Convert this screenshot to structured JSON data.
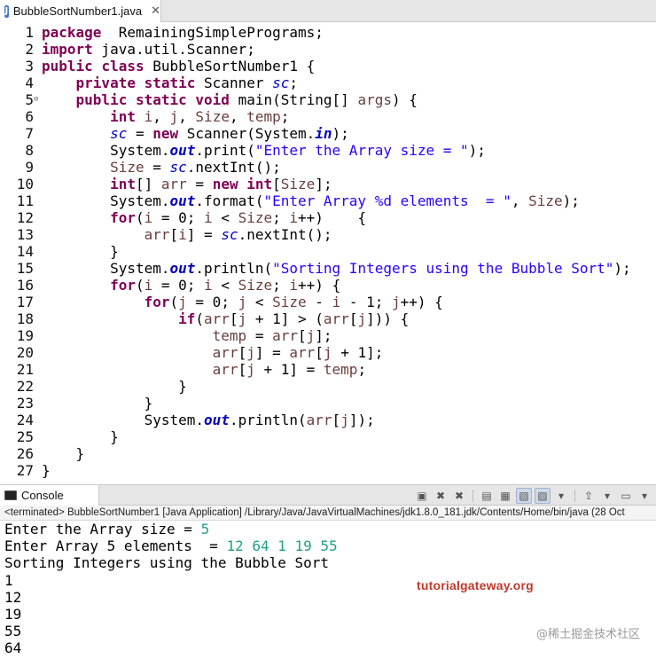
{
  "editor_tab": {
    "title": "BubbleSortNumber1.java",
    "close": "✕",
    "file_icon_letter": "J"
  },
  "code_lines": [
    {
      "num": "1",
      "fold": "",
      "segs": [
        [
          "kw",
          "package"
        ],
        [
          "",
          "  RemainingSimplePrograms;"
        ]
      ]
    },
    {
      "num": "2",
      "fold": "",
      "segs": [
        [
          "kw",
          "import"
        ],
        [
          "",
          " java.util.Scanner;"
        ]
      ]
    },
    {
      "num": "3",
      "fold": "",
      "segs": [
        [
          "kw",
          "public"
        ],
        [
          "",
          " "
        ],
        [
          "kw",
          "class"
        ],
        [
          "",
          " BubbleSortNumber1 {"
        ]
      ]
    },
    {
      "num": "4",
      "fold": "",
      "segs": [
        [
          "",
          "    "
        ],
        [
          "kw",
          "private"
        ],
        [
          "",
          " "
        ],
        [
          "kw",
          "static"
        ],
        [
          "",
          " Scanner "
        ],
        [
          "fld",
          "sc"
        ],
        [
          "",
          ";"
        ]
      ]
    },
    {
      "num": "5",
      "fold": "⊖",
      "segs": [
        [
          "",
          "    "
        ],
        [
          "kw",
          "public"
        ],
        [
          "",
          " "
        ],
        [
          "kw",
          "static"
        ],
        [
          "",
          " "
        ],
        [
          "kw",
          "void"
        ],
        [
          "",
          " main(String[] "
        ],
        [
          "var",
          "args"
        ],
        [
          "",
          ") {"
        ]
      ]
    },
    {
      "num": "6",
      "fold": "",
      "segs": [
        [
          "",
          "        "
        ],
        [
          "kw",
          "int"
        ],
        [
          "",
          " "
        ],
        [
          "var",
          "i"
        ],
        [
          "",
          ", "
        ],
        [
          "var",
          "j"
        ],
        [
          "",
          ", "
        ],
        [
          "var",
          "Size"
        ],
        [
          "",
          ", "
        ],
        [
          "var",
          "temp"
        ],
        [
          "",
          ";"
        ]
      ]
    },
    {
      "num": "7",
      "fold": "",
      "segs": [
        [
          "",
          "        "
        ],
        [
          "fld",
          "sc"
        ],
        [
          "",
          " = "
        ],
        [
          "kw",
          "new"
        ],
        [
          "",
          " Scanner(System."
        ],
        [
          "fldb",
          "in"
        ],
        [
          "",
          ");"
        ]
      ]
    },
    {
      "num": "8",
      "fold": "",
      "segs": [
        [
          "",
          "        System."
        ],
        [
          "fldb",
          "out"
        ],
        [
          "",
          ".print("
        ],
        [
          "str",
          "\"Enter the Array size = \""
        ],
        [
          "",
          ");"
        ]
      ]
    },
    {
      "num": "9",
      "fold": "",
      "segs": [
        [
          "",
          "        "
        ],
        [
          "var",
          "Size"
        ],
        [
          "",
          " = "
        ],
        [
          "fld",
          "sc"
        ],
        [
          "",
          ".nextInt();"
        ]
      ]
    },
    {
      "num": "10",
      "fold": "",
      "segs": [
        [
          "",
          "        "
        ],
        [
          "kw",
          "int"
        ],
        [
          "",
          "[] "
        ],
        [
          "var",
          "arr"
        ],
        [
          "",
          " = "
        ],
        [
          "kw",
          "new"
        ],
        [
          "",
          " "
        ],
        [
          "kw",
          "int"
        ],
        [
          "",
          "["
        ],
        [
          "var",
          "Size"
        ],
        [
          "",
          "];"
        ]
      ]
    },
    {
      "num": "11",
      "fold": "",
      "segs": [
        [
          "",
          "        System."
        ],
        [
          "fldb",
          "out"
        ],
        [
          "",
          ".format("
        ],
        [
          "str",
          "\"Enter Array %d elements  = \""
        ],
        [
          "",
          ", "
        ],
        [
          "var",
          "Size"
        ],
        [
          "",
          ");"
        ]
      ]
    },
    {
      "num": "12",
      "fold": "",
      "segs": [
        [
          "",
          "        "
        ],
        [
          "kw",
          "for"
        ],
        [
          "",
          "("
        ],
        [
          "var",
          "i"
        ],
        [
          "",
          " = 0; "
        ],
        [
          "var",
          "i"
        ],
        [
          "",
          " < "
        ],
        [
          "var",
          "Size"
        ],
        [
          "",
          "; "
        ],
        [
          "var",
          "i"
        ],
        [
          "",
          "++)    {"
        ]
      ]
    },
    {
      "num": "13",
      "fold": "",
      "segs": [
        [
          "",
          "            "
        ],
        [
          "var",
          "arr"
        ],
        [
          "",
          "["
        ],
        [
          "var",
          "i"
        ],
        [
          "",
          "] = "
        ],
        [
          "fld",
          "sc"
        ],
        [
          "",
          ".nextInt();"
        ]
      ]
    },
    {
      "num": "14",
      "fold": "",
      "segs": [
        [
          "",
          "        }"
        ]
      ]
    },
    {
      "num": "15",
      "fold": "",
      "segs": [
        [
          "",
          "        System."
        ],
        [
          "fldb",
          "out"
        ],
        [
          "",
          ".println("
        ],
        [
          "str",
          "\"Sorting Integers using the Bubble Sort\""
        ],
        [
          "",
          ");"
        ]
      ]
    },
    {
      "num": "16",
      "fold": "",
      "segs": [
        [
          "",
          "        "
        ],
        [
          "kw",
          "for"
        ],
        [
          "",
          "("
        ],
        [
          "var",
          "i"
        ],
        [
          "",
          " = 0; "
        ],
        [
          "var",
          "i"
        ],
        [
          "",
          " < "
        ],
        [
          "var",
          "Size"
        ],
        [
          "",
          "; "
        ],
        [
          "var",
          "i"
        ],
        [
          "",
          "++) {"
        ]
      ]
    },
    {
      "num": "17",
      "fold": "",
      "segs": [
        [
          "",
          "            "
        ],
        [
          "kw",
          "for"
        ],
        [
          "",
          "("
        ],
        [
          "var",
          "j"
        ],
        [
          "",
          " = 0; "
        ],
        [
          "var",
          "j"
        ],
        [
          "",
          " < "
        ],
        [
          "var",
          "Size"
        ],
        [
          "",
          " - "
        ],
        [
          "var",
          "i"
        ],
        [
          "",
          " - 1; "
        ],
        [
          "var",
          "j"
        ],
        [
          "",
          "++) {"
        ]
      ]
    },
    {
      "num": "18",
      "fold": "",
      "segs": [
        [
          "",
          "                "
        ],
        [
          "kw",
          "if"
        ],
        [
          "",
          "("
        ],
        [
          "var",
          "arr"
        ],
        [
          "",
          "["
        ],
        [
          "var",
          "j"
        ],
        [
          "",
          " + 1] > ("
        ],
        [
          "var",
          "arr"
        ],
        [
          "",
          "["
        ],
        [
          "var",
          "j"
        ],
        [
          "",
          "])) {"
        ]
      ]
    },
    {
      "num": "19",
      "fold": "",
      "segs": [
        [
          "",
          "                    "
        ],
        [
          "var",
          "temp"
        ],
        [
          "",
          " = "
        ],
        [
          "var",
          "arr"
        ],
        [
          "",
          "["
        ],
        [
          "var",
          "j"
        ],
        [
          "",
          "];"
        ]
      ]
    },
    {
      "num": "20",
      "fold": "",
      "segs": [
        [
          "",
          "                    "
        ],
        [
          "var",
          "arr"
        ],
        [
          "",
          "["
        ],
        [
          "var",
          "j"
        ],
        [
          "",
          "] = "
        ],
        [
          "var",
          "arr"
        ],
        [
          "",
          "["
        ],
        [
          "var",
          "j"
        ],
        [
          "",
          " + 1];"
        ]
      ]
    },
    {
      "num": "21",
      "fold": "",
      "segs": [
        [
          "",
          "                    "
        ],
        [
          "var",
          "arr"
        ],
        [
          "",
          "["
        ],
        [
          "var",
          "j"
        ],
        [
          "",
          " + 1] = "
        ],
        [
          "var",
          "temp"
        ],
        [
          "",
          ";"
        ]
      ]
    },
    {
      "num": "22",
      "fold": "",
      "segs": [
        [
          "",
          "                }"
        ]
      ]
    },
    {
      "num": "23",
      "fold": "",
      "segs": [
        [
          "",
          "            }"
        ]
      ]
    },
    {
      "num": "24",
      "fold": "",
      "segs": [
        [
          "",
          "            System."
        ],
        [
          "fldb",
          "out"
        ],
        [
          "",
          ".println("
        ],
        [
          "var",
          "arr"
        ],
        [
          "",
          "["
        ],
        [
          "var",
          "j"
        ],
        [
          "",
          "]);"
        ]
      ]
    },
    {
      "num": "25",
      "fold": "",
      "segs": [
        [
          "",
          "        }"
        ]
      ]
    },
    {
      "num": "26",
      "fold": "",
      "segs": [
        [
          "",
          "    }"
        ]
      ]
    },
    {
      "num": "27",
      "fold": "",
      "segs": [
        [
          "",
          "}"
        ]
      ]
    }
  ],
  "console": {
    "tab_label": "Console",
    "status": "<terminated> BubbleSortNumber1 [Java Application] /Library/Java/JavaVirtualMachines/jdk1.8.0_181.jdk/Contents/Home/bin/java  (28 Oct",
    "toolbar_glyphs": [
      "▣",
      "✖",
      "✖",
      "▤",
      "▦",
      "▧",
      "▨",
      "▾",
      "⇪",
      "▾",
      "▭",
      "▾"
    ],
    "output": [
      {
        "text": "Enter the Array size = ",
        "input": "5"
      },
      {
        "text": "Enter Array 5 elements  = ",
        "input": "12 64 1 19 55"
      },
      {
        "text": "Sorting Integers using the Bubble Sort",
        "input": ""
      },
      {
        "text": "1",
        "input": ""
      },
      {
        "text": "12",
        "input": ""
      },
      {
        "text": "19",
        "input": ""
      },
      {
        "text": "55",
        "input": ""
      },
      {
        "text": "64",
        "input": ""
      }
    ]
  },
  "watermark": {
    "brand": "tutorialgateway.org",
    "site": "@稀土掘金技术社区"
  },
  "colors": {
    "keyword": "#7f0055",
    "string": "#2a00ff",
    "field": "#0000c0",
    "local": "#6a3e3e",
    "console_input": "#1fa086",
    "brand": "#c0392b"
  }
}
